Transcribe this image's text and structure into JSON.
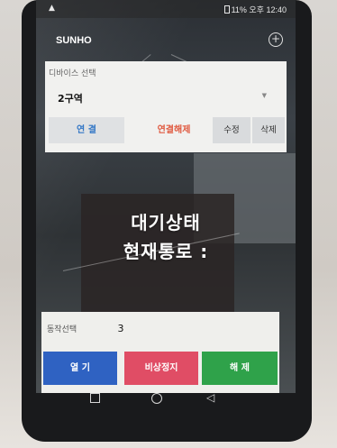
{
  "status_bar": {
    "left_icon": "▲",
    "right_text": "11% 오후 12:40"
  },
  "app_bar": {
    "title": "SUNHO",
    "add_icon": "plus-circle-icon"
  },
  "device_panel": {
    "label": "디바이스 선택",
    "selected_device": "2구역",
    "buttons": {
      "connect": "연 결",
      "disconnect": "연결해제",
      "edit": "수정",
      "delete": "삭제"
    }
  },
  "status": {
    "line1": "대기상태",
    "line2": "현재통로 :"
  },
  "control_panel": {
    "operation_label": "동작선택",
    "operation_value": "3",
    "buttons": {
      "open": "열 기",
      "emergency_stop": "비상정지",
      "release": "해 제"
    }
  },
  "colors": {
    "connect_text": "#3377c6",
    "disconnect_text": "#e05a40",
    "open_button": "#2f62c2",
    "stop_button": "#e04d65",
    "release_button": "#2fa24a"
  }
}
